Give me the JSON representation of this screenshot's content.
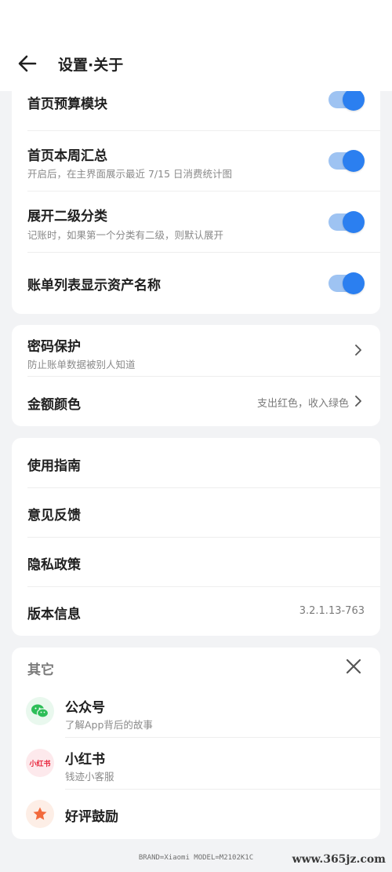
{
  "header": {
    "title": "设置·关于"
  },
  "toggles": [
    {
      "title": "首页预算模块",
      "subtitle": ""
    },
    {
      "title": "首页本周汇总",
      "subtitle": "开启后，在主界面展示最近 7/15 日消费统计图"
    },
    {
      "title": "展开二级分类",
      "subtitle": "记账时，如果第一个分类有二级，则默认展开"
    },
    {
      "title": "账单列表显示资产名称",
      "subtitle": ""
    }
  ],
  "security": {
    "password_title": "密码保护",
    "password_sub": "防止账单数据被别人知道",
    "color_title": "金额颜色",
    "color_value": "支出红色，收入绿色"
  },
  "info": {
    "guide": "使用指南",
    "feedback": "意见反馈",
    "privacy": "隐私政策",
    "version_label": "版本信息",
    "version_value": "3.2.1.13-763"
  },
  "other": {
    "section_title": "其它",
    "items": [
      {
        "title": "公众号",
        "subtitle": "了解App背后的故事",
        "icon": "wechat-icon"
      },
      {
        "title": "小红书",
        "subtitle": "钱迹小客服",
        "icon": "xiaohongshu-icon",
        "icon_text": "小红书"
      },
      {
        "title": "好评鼓励",
        "subtitle": "",
        "icon": "star-icon"
      }
    ]
  },
  "footer": {
    "device": "BRAND=Xiaomi MODEL=M2102K1C",
    "watermark": "www.365jz.com"
  },
  "colors": {
    "accent": "#2b7ff0",
    "accent_track": "#9ec3f2",
    "background": "#f2f3f5"
  }
}
